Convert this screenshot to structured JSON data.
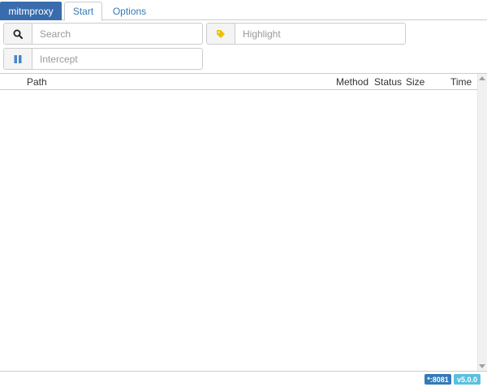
{
  "header": {
    "brand": "mitmproxy",
    "tabs": [
      {
        "label": "Start",
        "active": true
      },
      {
        "label": "Options",
        "active": false
      }
    ]
  },
  "filters": {
    "search": {
      "placeholder": "Search",
      "icon": "search-icon"
    },
    "highlight": {
      "placeholder": "Highlight",
      "icon": "tag-icon",
      "icon_color": "#f0c000"
    },
    "intercept": {
      "placeholder": "Intercept",
      "icon": "pause-icon",
      "icon_color": "#4a86c5"
    }
  },
  "table": {
    "columns": [
      "Path",
      "Method",
      "Status",
      "Size",
      "Time"
    ],
    "rows": []
  },
  "footer": {
    "port_badge": "*:8081",
    "version_badge": "v5.0.0"
  },
  "colors": {
    "brand": "#396cad",
    "link": "#337ab7",
    "badge_port": "#337ab7",
    "badge_version": "#5bc0de"
  }
}
